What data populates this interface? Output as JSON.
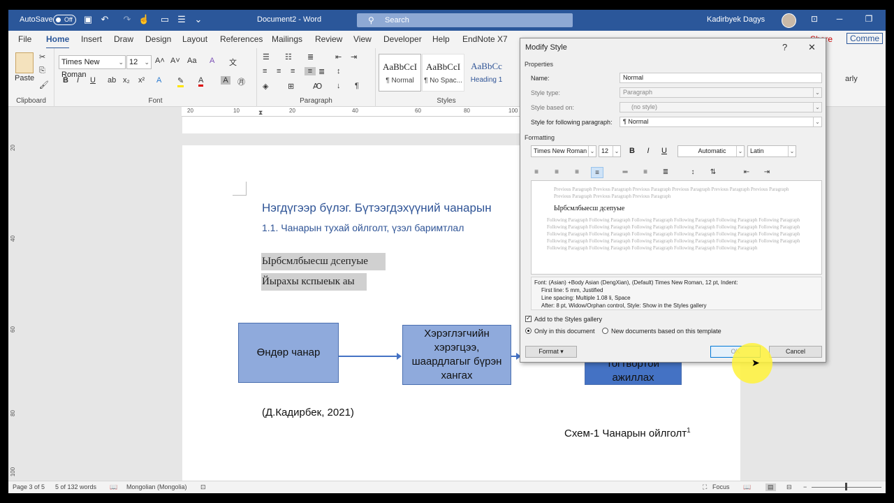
{
  "titlebar": {
    "autosave_label": "AutoSave",
    "autosave_state": "Off",
    "document_title": "Document2  -  Word",
    "search_placeholder": "Search",
    "user_name": "Kadirbyek Dagys"
  },
  "tabs": [
    "File",
    "Home",
    "Insert",
    "Draw",
    "Design",
    "Layout",
    "References",
    "Mailings",
    "Review",
    "View",
    "Developer",
    "Help",
    "EndNote X7"
  ],
  "active_tab": "Home",
  "ribbon": {
    "clipboard": {
      "label": "Clipboard",
      "paste": "Paste"
    },
    "font": {
      "label": "Font",
      "family": "Times New Roman",
      "size": "12",
      "bold": "B",
      "italic": "I",
      "underline": "U"
    },
    "paragraph": {
      "label": "Paragraph"
    },
    "styles": {
      "label": "Styles",
      "items": [
        {
          "preview": "AaBbCcI",
          "name": "¶ Normal"
        },
        {
          "preview": "AaBbCcI",
          "name": "¶ No Spac..."
        },
        {
          "preview": "AaBbCc",
          "name": "Heading 1"
        }
      ]
    },
    "share_partial": "Share",
    "comments_partial": "Comme",
    "right_partial": "arly"
  },
  "ruler": {
    "marks": [
      "20",
      "10",
      "20",
      "40",
      "60",
      "80",
      "100"
    ]
  },
  "vruler": {
    "marks": [
      "20",
      "40",
      "60",
      "80",
      "100"
    ]
  },
  "document": {
    "heading1": "Нэгдүгээр бүлэг. Бүтээгдэхүүний чанарын",
    "heading2": "1.1. Чанарын тухай ойлголт, үзэл баримтлал",
    "highlight1": "Ырбсмлбыесш дсепуые",
    "highlight2": "Йырахы кспыеык аы",
    "shapes": [
      "Өндөр чанар",
      "Хэрэглэгчийн хэрэгцээ, шаардлагыг бүрэн хангах",
      "тогтвортой ажиллах"
    ],
    "citation": "(Д.Кадирбек, 2021)",
    "caption": "Схем-1 Чанарын ойлголт",
    "caption_sup": "1"
  },
  "statusbar": {
    "page": "Page 3 of 5",
    "words": "5 of 132 words",
    "language": "Mongolian (Mongolia)",
    "focus": "Focus"
  },
  "dialog": {
    "title": "Modify Style",
    "help": "?",
    "close": "✕",
    "properties_label": "Properties",
    "name_label": "Name:",
    "name_value": "Normal",
    "type_label": "Style type:",
    "type_value": "Paragraph",
    "based_label": "Style based on:",
    "based_value": "(no style)",
    "following_label": "Style for following paragraph:",
    "following_value": "¶ Normal",
    "formatting_label": "Formatting",
    "font": "Times New Roman",
    "size": "12",
    "bold": "B",
    "italic": "I",
    "underline": "U",
    "color": "Automatic",
    "script": "Latin",
    "preview_prev": "Previous Paragraph Previous Paragraph Previous Paragraph Previous Paragraph Previous Paragraph Previous Paragraph Previous Paragraph Previous Paragraph Previous Paragraph",
    "preview_text": "Ырбсмлбыесш дсепуыe",
    "preview_follow": "Following Paragraph Following Paragraph Following Paragraph Following Paragraph Following Paragraph Following Paragraph Following Paragraph Following Paragraph Following Paragraph Following Paragraph Following Paragraph Following Paragraph Following Paragraph Following Paragraph Following Paragraph Following Paragraph Following Paragraph Following Paragraph Following Paragraph Following Paragraph Following Paragraph Following Paragraph Following Paragraph Following Paragraph Following Paragraph Following Paragraph Following Paragraph Following Paragraph Following Paragraph",
    "desc_line1": "Font: (Asian) +Body Asian (DengXian), (Default) Times New Roman, 12 pt, Indent:",
    "desc_line2": "First line:  5 mm, Justified",
    "desc_line3": "Line spacing:  Multiple 1.08 li, Space",
    "desc_line4": "After:  8 pt, Widow/Orphan control, Style: Show in the Styles gallery",
    "add_gallery": "Add to the Styles gallery",
    "only_doc": "Only in this document",
    "new_docs": "New documents based on this template",
    "format_btn": "Format ▾",
    "ok_btn": "OK",
    "cancel_btn": "Cancel"
  }
}
